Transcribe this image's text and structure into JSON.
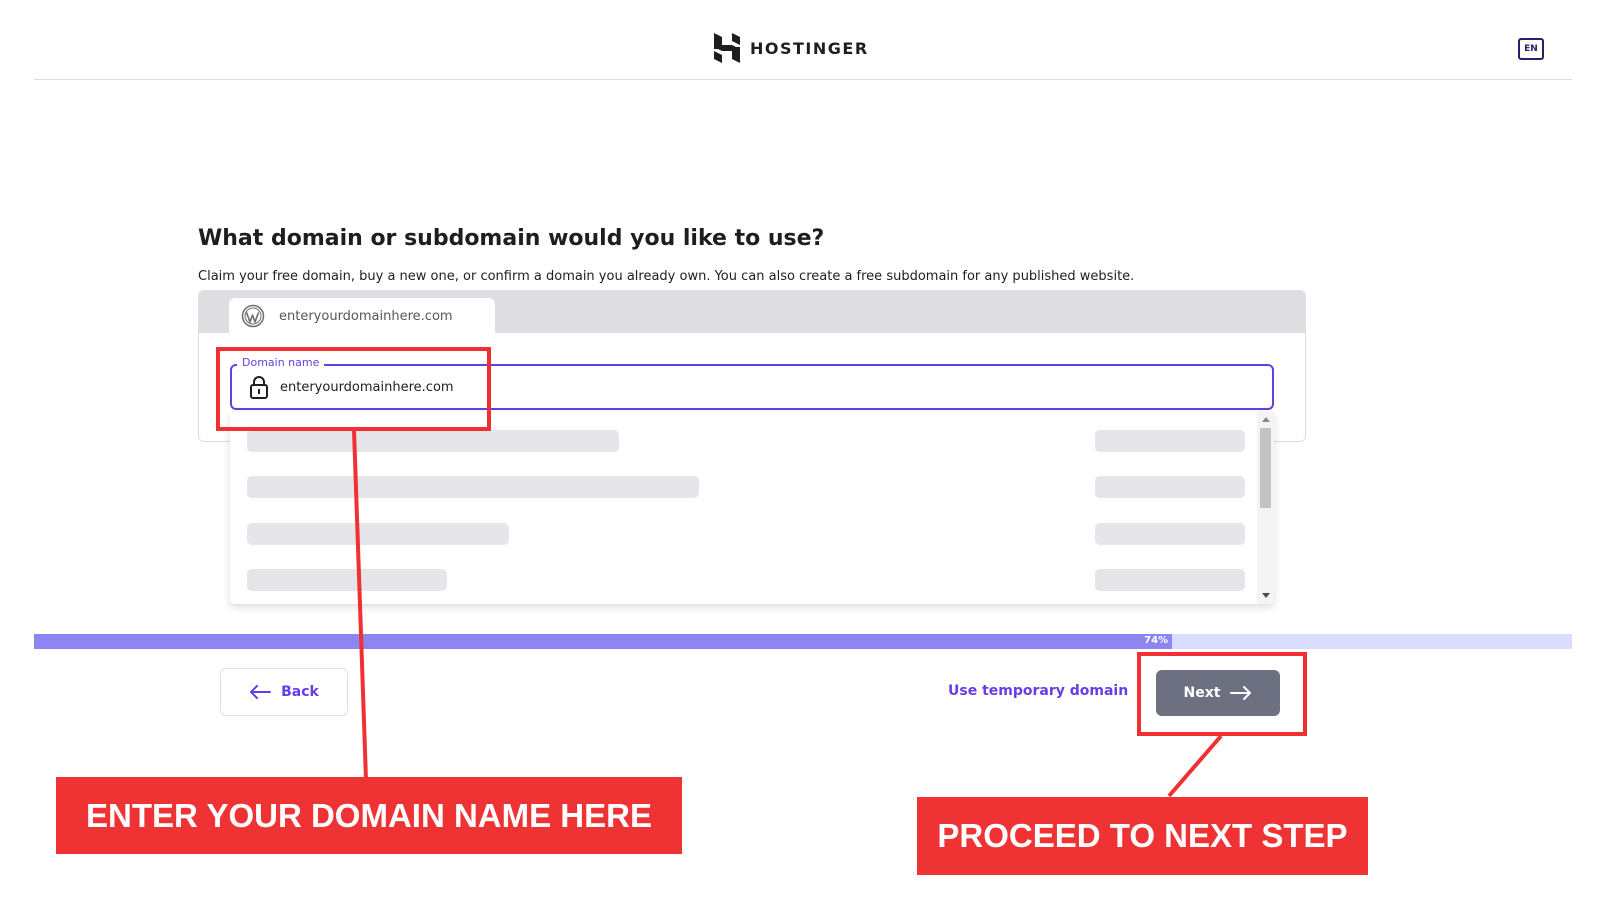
{
  "header": {
    "brand": "HOSTINGER",
    "language": "EN"
  },
  "main": {
    "title": "What domain or subdomain would you like to use?",
    "subtitle": "Claim your free domain, buy a new one, or confirm a domain you already own. You can also create a free subdomain for any published website.",
    "tab": {
      "icon": "wordpress-icon",
      "label": "enteryourdomainhere.com"
    },
    "domain_field": {
      "legend": "Domain name",
      "icon": "lock-icon",
      "value": "enteryourdomainhere.com"
    }
  },
  "progress": {
    "value": 0.74,
    "label": "74%"
  },
  "footer": {
    "back_label": "Back",
    "temp_domain_label": "Use temporary domain",
    "next_label": "Next"
  },
  "annotations": {
    "domain_callout": "ENTER YOUR DOMAIN NAME HERE",
    "next_callout": "PROCEED TO NEXT STEP"
  },
  "colors": {
    "accent": "#673de6",
    "progress_fill": "#8c85f2",
    "progress_track": "#d8dcff",
    "next_button": "#6d7081",
    "annotation_red": "#ef3334"
  }
}
